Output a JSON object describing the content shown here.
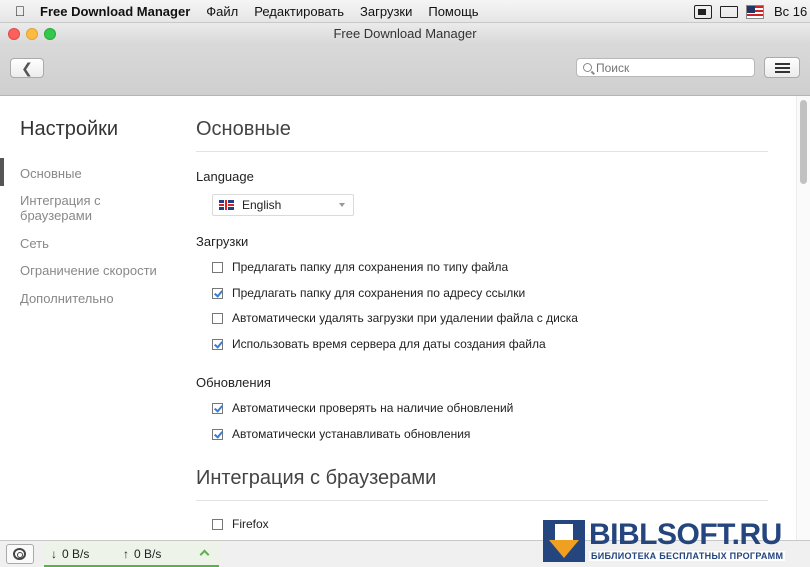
{
  "menubar": {
    "app_name": "Free Download Manager",
    "items": [
      "Файл",
      "Редактировать",
      "Загрузки",
      "Помощь"
    ],
    "clock": "Вс 16"
  },
  "window": {
    "title": "Free Download Manager"
  },
  "toolbar": {
    "search_placeholder": "Поиск"
  },
  "sidebar": {
    "title": "Настройки",
    "items": [
      "Основные",
      "Интеграция с браузерами",
      "Сеть",
      "Ограничение скорости",
      "Дополнительно"
    ],
    "active_index": 0
  },
  "main": {
    "section_general": "Основные",
    "language_label": "Language",
    "language_value": "English",
    "downloads_label": "Загрузки",
    "downloads_options": [
      {
        "label": "Предлагать папку для сохранения по типу файла",
        "checked": false
      },
      {
        "label": "Предлагать папку для сохранения по адресу ссылки",
        "checked": true
      },
      {
        "label": "Автоматически удалять загрузки при удалении файла с диска",
        "checked": false
      },
      {
        "label": "Использовать время сервера для даты создания файла",
        "checked": true
      }
    ],
    "updates_label": "Обновления",
    "updates_options": [
      {
        "label": "Автоматически проверять на наличие обновлений",
        "checked": true
      },
      {
        "label": "Автоматически устанавливать обновления",
        "checked": true
      }
    ],
    "section_integration": "Интеграция с браузерами",
    "integration_options": [
      {
        "label": "Firefox",
        "checked": false
      }
    ]
  },
  "statusbar": {
    "download_speed": "0 B/s",
    "upload_speed": "0 B/s"
  },
  "watermark": {
    "title": "BIBLSOFT.RU",
    "subtitle": "БИБЛИОТЕКА БЕСПЛАТНЫХ ПРОГРАММ"
  },
  "colors": {
    "accent_check": "#3b7bd0",
    "speed_accent": "#5ab04a",
    "watermark": "#24457e"
  }
}
